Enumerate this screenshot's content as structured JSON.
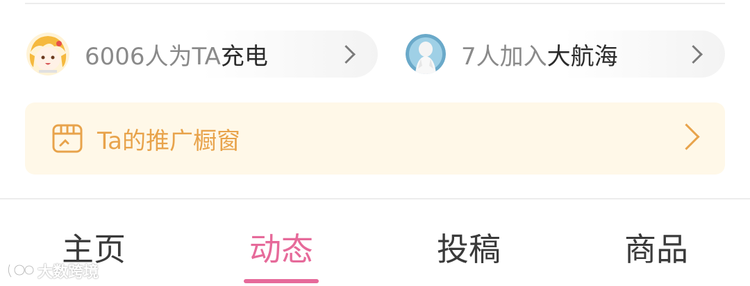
{
  "supporters": {
    "count_text": "6006人为TA",
    "action_text": "充电"
  },
  "fleet": {
    "count_text": "7人加入",
    "name_text": "大航海"
  },
  "showcase": {
    "label": "Ta的推广橱窗",
    "icon": "shop-showcase-icon"
  },
  "tabs": [
    {
      "label": "主页",
      "active": false
    },
    {
      "label": "动态",
      "active": true
    },
    {
      "label": "投稿",
      "active": false
    },
    {
      "label": "商品",
      "active": false
    }
  ],
  "watermark": {
    "text": "大数跨境"
  },
  "colors": {
    "accent_pink": "#e66a9a",
    "showcase_orange": "#e8a34b",
    "showcase_bg": "#fff8e8"
  }
}
